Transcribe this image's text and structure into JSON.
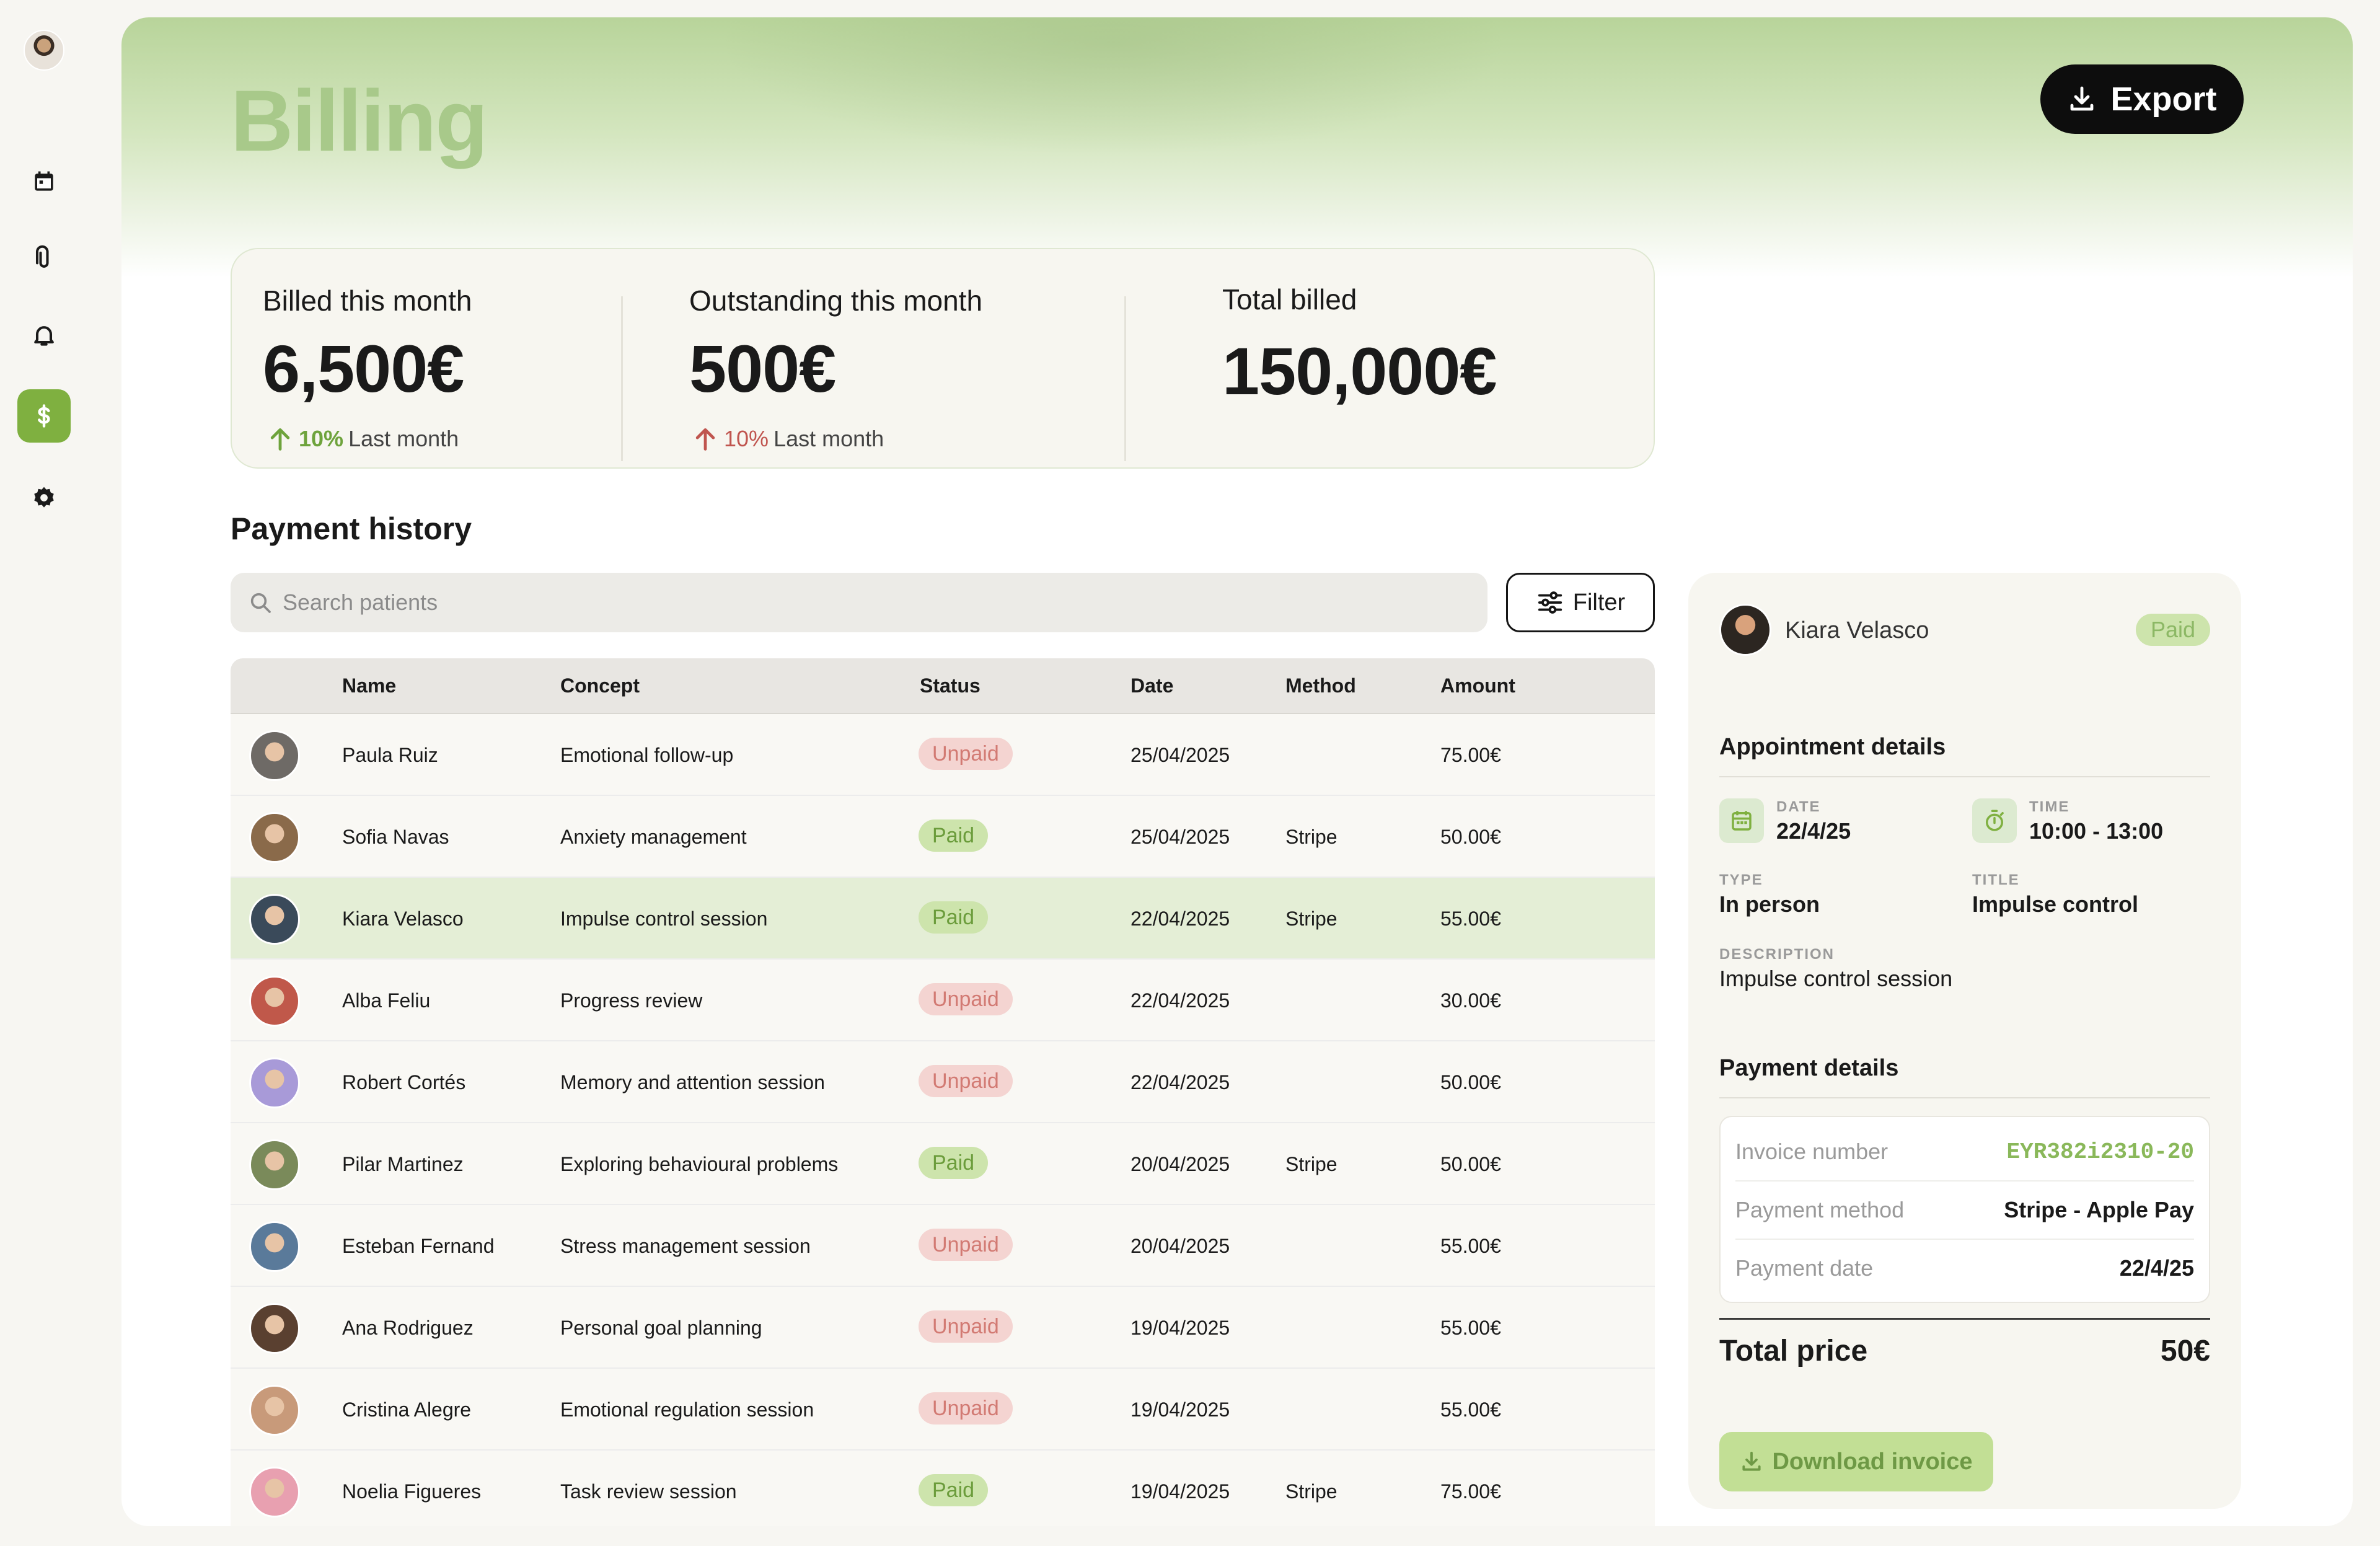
{
  "page": {
    "title": "Billing",
    "export_label": "Export"
  },
  "sidebar": {
    "items": [
      {
        "name": "calendar"
      },
      {
        "name": "attachments"
      },
      {
        "name": "notifications"
      },
      {
        "name": "billing",
        "active": true
      },
      {
        "name": "settings"
      }
    ]
  },
  "stats": {
    "billed": {
      "label": "Billed this month",
      "value": "6,500€",
      "pct": "10%",
      "trend_label": "Last month",
      "color": "#6ea33c"
    },
    "outstanding": {
      "label": "Outstanding this month",
      "value": "500€",
      "pct": "10%",
      "trend_label": "Last month",
      "color": "#c0554f"
    },
    "total": {
      "label": "Total billed",
      "value": "150,000€"
    }
  },
  "history": {
    "title": "Payment history",
    "search_placeholder": "Search patients",
    "filter_label": "Filter",
    "columns": {
      "name": "Name",
      "concept": "Concept",
      "status": "Status",
      "date": "Date",
      "method": "Method",
      "amount": "Amount"
    },
    "rows": [
      {
        "name": "Paula Ruiz",
        "concept": "Emotional follow-up",
        "status": "Unpaid",
        "date": "25/04/2025",
        "method": "",
        "amount": "75.00€",
        "avatar": "#6e6a66"
      },
      {
        "name": "Sofia Navas",
        "concept": "Anxiety management",
        "status": "Paid",
        "date": "25/04/2025",
        "method": "Stripe",
        "amount": "50.00€",
        "avatar": "#8a6a4a"
      },
      {
        "name": "Kiara Velasco",
        "concept": "Impulse control session",
        "status": "Paid",
        "date": "22/04/2025",
        "method": "Stripe",
        "amount": "55.00€",
        "avatar": "#3a4a5a"
      },
      {
        "name": "Alba Feliu",
        "concept": "Progress review",
        "status": "Unpaid",
        "date": "22/04/2025",
        "method": "",
        "amount": "30.00€",
        "avatar": "#c0584a"
      },
      {
        "name": "Robert Cortés",
        "concept": "Memory and attention session",
        "status": "Unpaid",
        "date": "22/04/2025",
        "method": "",
        "amount": "50.00€",
        "avatar": "#a89ad8"
      },
      {
        "name": "Pilar Martinez",
        "concept": "Exploring behavioural problems",
        "status": "Paid",
        "date": "20/04/2025",
        "method": "Stripe",
        "amount": "50.00€",
        "avatar": "#7a8a5a"
      },
      {
        "name": "Esteban Fernand",
        "concept": "Stress management session",
        "status": "Unpaid",
        "date": "20/04/2025",
        "method": "",
        "amount": "55.00€",
        "avatar": "#5a7a9a"
      },
      {
        "name": "Ana Rodriguez",
        "concept": "Personal goal planning",
        "status": "Unpaid",
        "date": "19/04/2025",
        "method": "",
        "amount": "55.00€",
        "avatar": "#5a4030"
      },
      {
        "name": "Cristina Alegre",
        "concept": "Emotional regulation session",
        "status": "Unpaid",
        "date": "19/04/2025",
        "method": "",
        "amount": "55.00€",
        "avatar": "#c89a7a"
      },
      {
        "name": "Noelia Figueres",
        "concept": "Task review session",
        "status": "Paid",
        "date": "19/04/2025",
        "method": "Stripe",
        "amount": "75.00€",
        "avatar": "#e8a0b0"
      }
    ]
  },
  "detail": {
    "patient_name": "Kiara Velasco",
    "status": "Paid",
    "appointment_heading": "Appointment details",
    "date_key": "DATE",
    "date_value": "22/4/25",
    "time_key": "TIME",
    "time_value": "10:00 - 13:00",
    "type_key": "TYPE",
    "type_value": "In person",
    "title_key": "TITLE",
    "title_value": "Impulse control",
    "description_key": "DESCRIPTION",
    "description_value": "Impulse control session",
    "payment_heading": "Payment details",
    "invoice_key": "Invoice number",
    "invoice_value": "EYR382i2310-20",
    "method_key": "Payment method",
    "method_value": "Stripe - Apple Pay",
    "paydate_key": "Payment date",
    "paydate_value": "22/4/25",
    "total_key": "Total price",
    "total_value": "50€",
    "download_label": "Download invoice"
  },
  "colors": {
    "accent": "#7fb040",
    "paid_bg": "#cde4ac",
    "unpaid_bg": "#f4d4d1"
  }
}
